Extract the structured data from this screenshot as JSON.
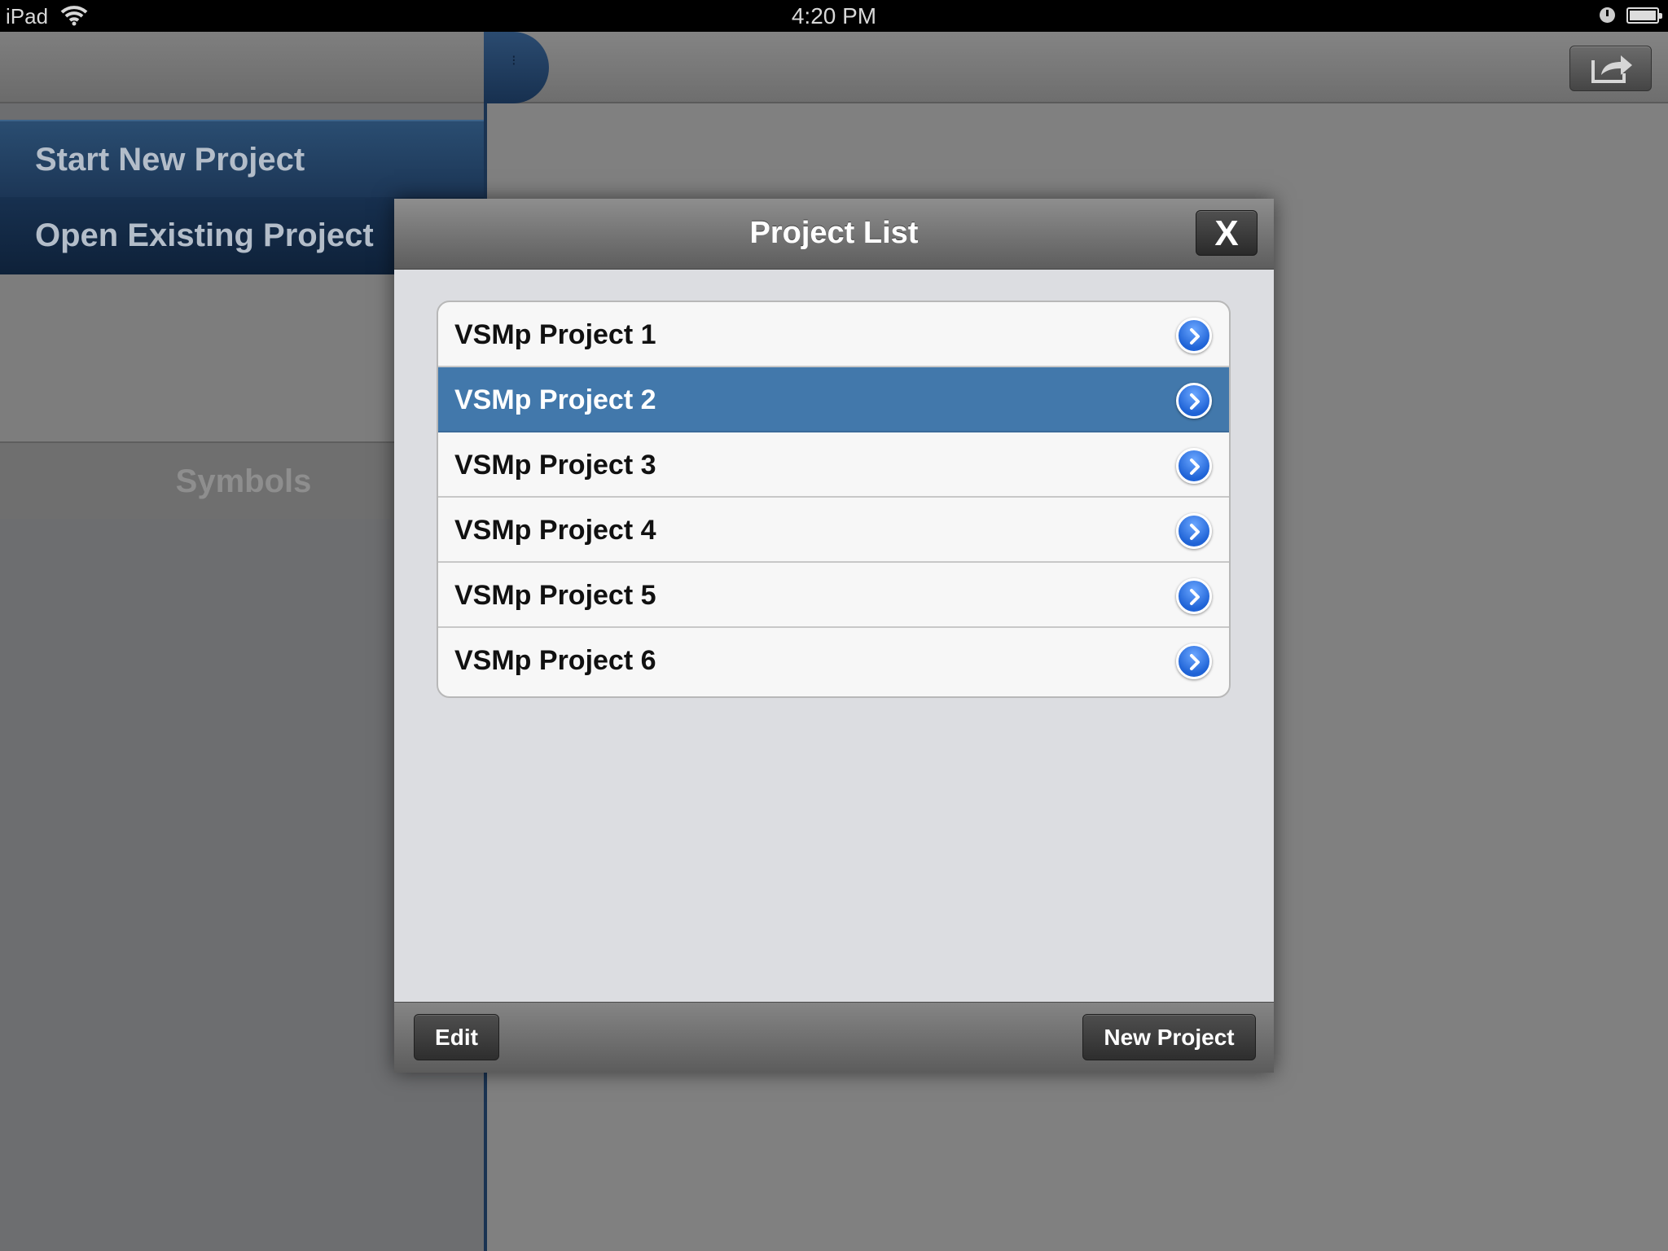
{
  "status_bar": {
    "device": "iPad",
    "time": "4:20 PM",
    "icons": [
      "wifi-icon",
      "clock-icon",
      "battery-icon"
    ]
  },
  "sidebar": {
    "items": [
      {
        "label": "Start New Project"
      },
      {
        "label": "Open Existing Project"
      }
    ],
    "symbols_label": "Symbols"
  },
  "toolbar": {
    "share_icon": "share-icon"
  },
  "modal": {
    "title": "Project List",
    "close_label": "X",
    "projects": [
      {
        "label": "VSMp Project 1",
        "selected": false
      },
      {
        "label": "VSMp Project 2",
        "selected": true
      },
      {
        "label": "VSMp Project 3",
        "selected": false
      },
      {
        "label": "VSMp Project 4",
        "selected": false
      },
      {
        "label": "VSMp Project 5",
        "selected": false
      },
      {
        "label": "VSMp Project 6",
        "selected": false
      }
    ],
    "edit_label": "Edit",
    "new_project_label": "New Project"
  },
  "colors": {
    "selected_row": "#4278ab",
    "sidebar_accent": "#1c3656",
    "detail_disclosure": "#1f63d6"
  }
}
